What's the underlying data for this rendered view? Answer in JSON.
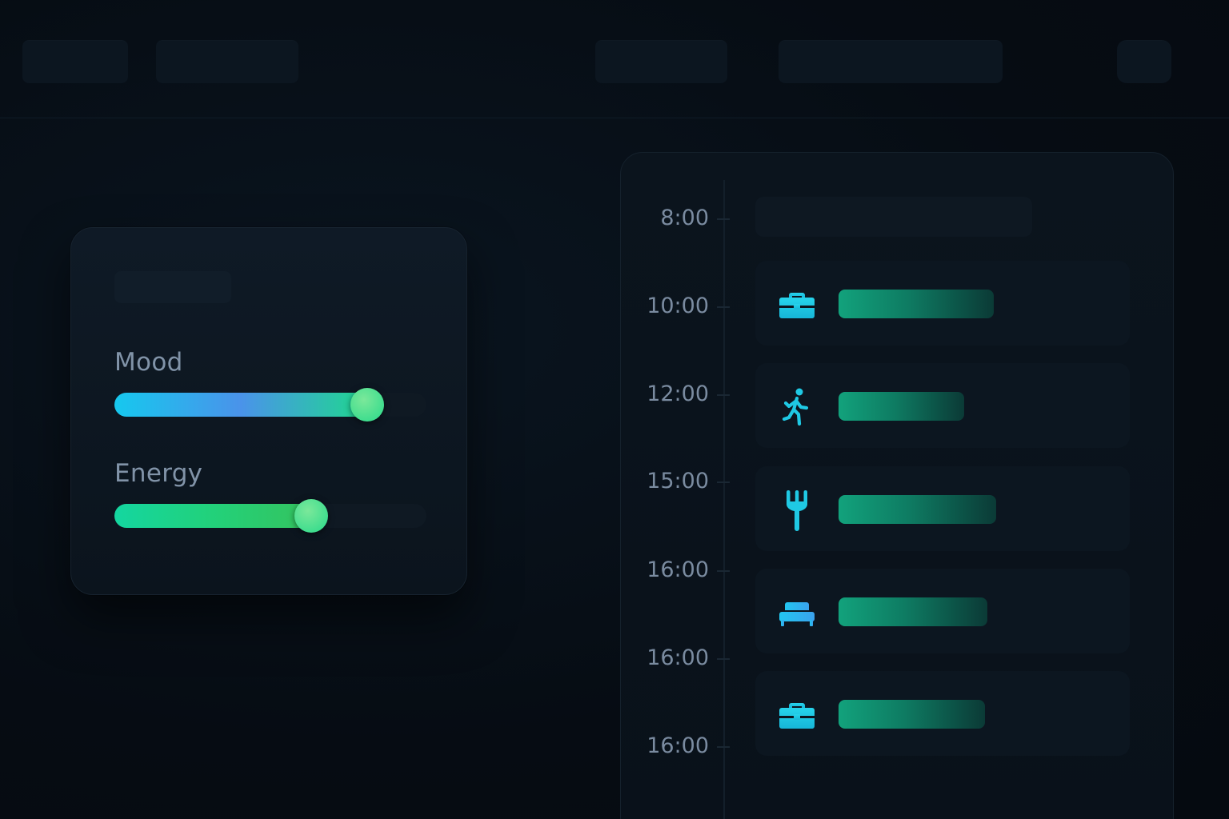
{
  "wellbeing": {
    "sliders": [
      {
        "label": "Mood",
        "value": 0.81
      },
      {
        "label": "Energy",
        "value": 0.63
      }
    ]
  },
  "schedule": {
    "times": [
      "8:00",
      "10:00",
      "12:00",
      "15:00",
      "16:00",
      "16:00",
      "16:00"
    ],
    "events": [
      {
        "icon": "briefcase-icon",
        "bar_fraction": 0.68
      },
      {
        "icon": "walking-person-icon",
        "bar_fraction": 0.55
      },
      {
        "icon": "fork-icon",
        "bar_fraction": 0.69
      },
      {
        "icon": "bed-icon",
        "bar_fraction": 0.65
      },
      {
        "icon": "briefcase-icon",
        "bar_fraction": 0.64
      }
    ]
  },
  "colors": {
    "accent_cyan": "#1ec8e6",
    "accent_green": "#28d98a",
    "mood_gradient": [
      "#16c8ee",
      "#4a93ea",
      "#1fd88e"
    ],
    "energy_gradient": [
      "#14d6a0",
      "#22d17a",
      "#35c35e"
    ]
  }
}
